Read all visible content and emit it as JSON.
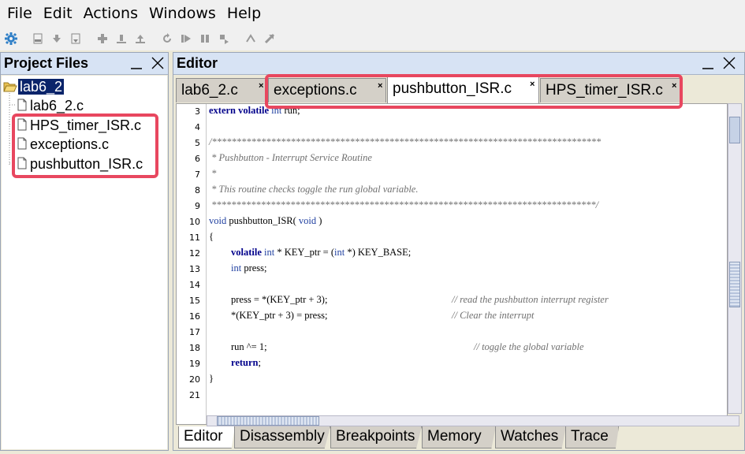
{
  "menu": {
    "items": [
      {
        "label": "File"
      },
      {
        "label": "Edit"
      },
      {
        "label": "Actions"
      },
      {
        "label": "Windows"
      },
      {
        "label": "Help"
      }
    ]
  },
  "project_panel": {
    "title": "Project Files",
    "root": "lab6_2",
    "files": [
      "lab6_2.c",
      "HPS_timer_ISR.c",
      "exceptions.c",
      "pushbutton_ISR.c"
    ]
  },
  "editor_panel": {
    "title": "Editor",
    "tabs": [
      {
        "label": "lab6_2.c",
        "close": "×"
      },
      {
        "label": "exceptions.c",
        "close": "×"
      },
      {
        "label": "pushbutton_ISR.c",
        "close": "×"
      },
      {
        "label": "HPS_timer_ISR.c",
        "close": "×"
      }
    ],
    "active_tab": "pushbutton_ISR.c",
    "code": {
      "line_numbers": [
        "3",
        "4",
        "5",
        "6",
        "7",
        "8",
        "9",
        "10",
        "11",
        "12",
        "13",
        "14",
        "15",
        "16",
        "17",
        "18",
        "19",
        "20",
        "21"
      ],
      "lines": {
        "l3_kw": "extern volatile",
        "l3_ty": " int",
        "l3_rest": " run;",
        "l5": "/*******************************************************************************",
        "l6": " * Pushbutton - Interrupt Service Routine",
        "l7": " *",
        "l8": " * This routine checks toggle the run global variable.",
        "l9": " ******************************************************************************/",
        "l10_ty": "void",
        "l10_mid": " pushbutton_ISR(",
        "l10_ty2": " void",
        "l10_end": " )",
        "l11": "{",
        "l12_kw": "volatile",
        "l12_ty": " int",
        "l12_mid": " * KEY_ptr = (",
        "l12_ty2": "int",
        "l12_end": " *) KEY_BASE;",
        "l13_ty": "int",
        "l13_rest": " press;",
        "l15_code": "press = *(KEY_ptr + 3);",
        "l15_cm": "// read the pushbutton interrupt register",
        "l16_code": "*(KEY_ptr + 3) = press;",
        "l16_cm": "// Clear the interrupt",
        "l18_code": "run ^= 1;",
        "l18_cm": "// toggle the global variable",
        "l19_kw": "return",
        "l19_rest": ";",
        "l20": "}"
      }
    },
    "bottom_tabs": [
      "Editor",
      "Disassembly",
      "Breakpoints",
      "Memory",
      "Watches",
      "Trace"
    ],
    "active_bottom_tab": "Editor"
  },
  "colors": {
    "highlight": "#e8475f",
    "panel_header": "#d7e3f4",
    "selection": "#0a246a"
  }
}
